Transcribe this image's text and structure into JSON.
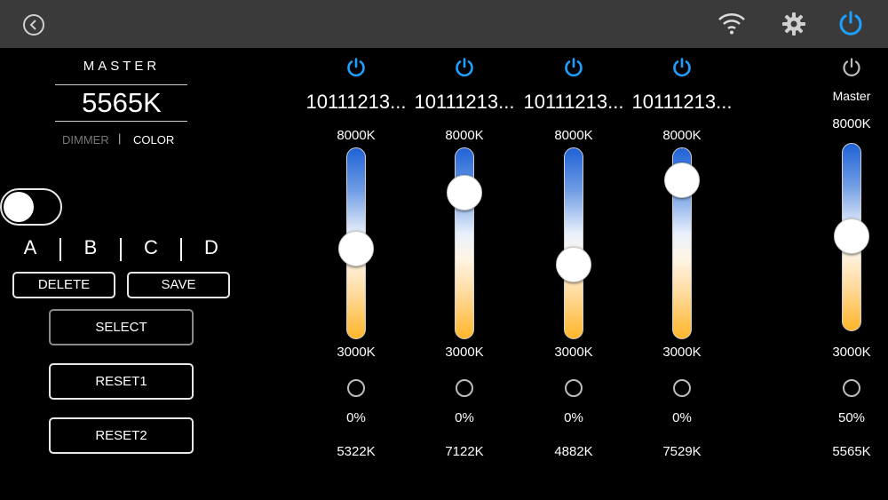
{
  "topbar": {
    "icons": [
      "back-icon",
      "wifi-icon",
      "gear-icon",
      "power-icon"
    ],
    "accent": "#1ea0ff"
  },
  "master_panel": {
    "title": "MASTER",
    "value": "5565K",
    "mode_dimmer": "DIMMER",
    "mode_separator": "|",
    "mode_color": "COLOR",
    "mode_active": "COLOR",
    "toggle_on": false
  },
  "presets": [
    "A",
    "B",
    "C",
    "D"
  ],
  "buttons": {
    "delete": "DELETE",
    "save": "SAVE",
    "select": "SELECT",
    "reset1": "RESET1",
    "reset2": "RESET2"
  },
  "channels": [
    {
      "name": "10111213...",
      "max": "8000K",
      "min": "3000K",
      "percent": "0%",
      "temp": "5322K",
      "level": 0.46,
      "power_on": true
    },
    {
      "name": "10111213...",
      "max": "8000K",
      "min": "3000K",
      "percent": "0%",
      "temp": "7122K",
      "level": 0.82,
      "power_on": true
    },
    {
      "name": "10111213...",
      "max": "8000K",
      "min": "3000K",
      "percent": "0%",
      "temp": "4882K",
      "level": 0.38,
      "power_on": true
    },
    {
      "name": "10111213...",
      "max": "8000K",
      "min": "3000K",
      "percent": "0%",
      "temp": "7529K",
      "level": 0.9,
      "power_on": true
    }
  ],
  "master_channel": {
    "name": "Master",
    "max": "8000K",
    "min": "3000K",
    "percent": "50%",
    "temp": "5565K",
    "level": 0.51,
    "power_on": false
  }
}
